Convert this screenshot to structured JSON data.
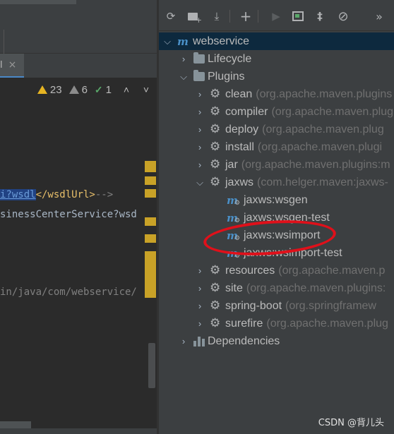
{
  "editor": {
    "tab_label": "l",
    "tab_close": "×",
    "status": {
      "warnings": "23",
      "weak_warnings": "6",
      "typos": "1",
      "up": "˄",
      "down": "˅"
    },
    "code_lines": [
      {
        "highlight": "i?wsdl",
        "tag": "</wsdlUrl>",
        "comment": "-->"
      },
      {
        "text": "sinessCenterService?wsd"
      },
      {
        "text": "in/java/com/webservice/"
      }
    ],
    "bottom_text": ">"
  },
  "maven": {
    "toolbar": {
      "reload": "⟳",
      "add_folder": "+",
      "download": "⤓",
      "add": "+",
      "run": "▶",
      "console": "▣",
      "toggle_offline": "‡",
      "skip_tests": "⊘",
      "more": "»"
    },
    "tree": {
      "root": "webservice",
      "lifecycle": "Lifecycle",
      "plugins": "Plugins",
      "plugin_items": [
        {
          "name": "clean",
          "group": "(org.apache.maven.plugins"
        },
        {
          "name": "compiler",
          "group": "(org.apache.maven.plug"
        },
        {
          "name": "deploy",
          "group": "(org.apache.maven.plug"
        },
        {
          "name": "install",
          "group": "(org.apache.maven.plugi"
        },
        {
          "name": "jar",
          "group": "(org.apache.maven.plugins:m"
        },
        {
          "name": "jaxws",
          "group": "(com.helger.maven:jaxws-"
        }
      ],
      "jaxws_goals": [
        "jaxws:wsgen",
        "jaxws:wsgen-test",
        "jaxws:wsimport",
        "jaxws:wsimport-test"
      ],
      "plugin_items_after": [
        {
          "name": "resources",
          "group": "(org.apache.maven.p"
        },
        {
          "name": "site",
          "group": "(org.apache.maven.plugins:"
        },
        {
          "name": "spring-boot",
          "group": "(org.springframew"
        },
        {
          "name": "surefire",
          "group": "(org.apache.maven.plug"
        }
      ],
      "dependencies": "Dependencies"
    },
    "annotation_color": "#e0101a"
  },
  "watermark": "CSDN @背儿头",
  "colors": {
    "accent": "#4a90c8",
    "selection": "#0d293e",
    "warning": "#e6b422"
  }
}
